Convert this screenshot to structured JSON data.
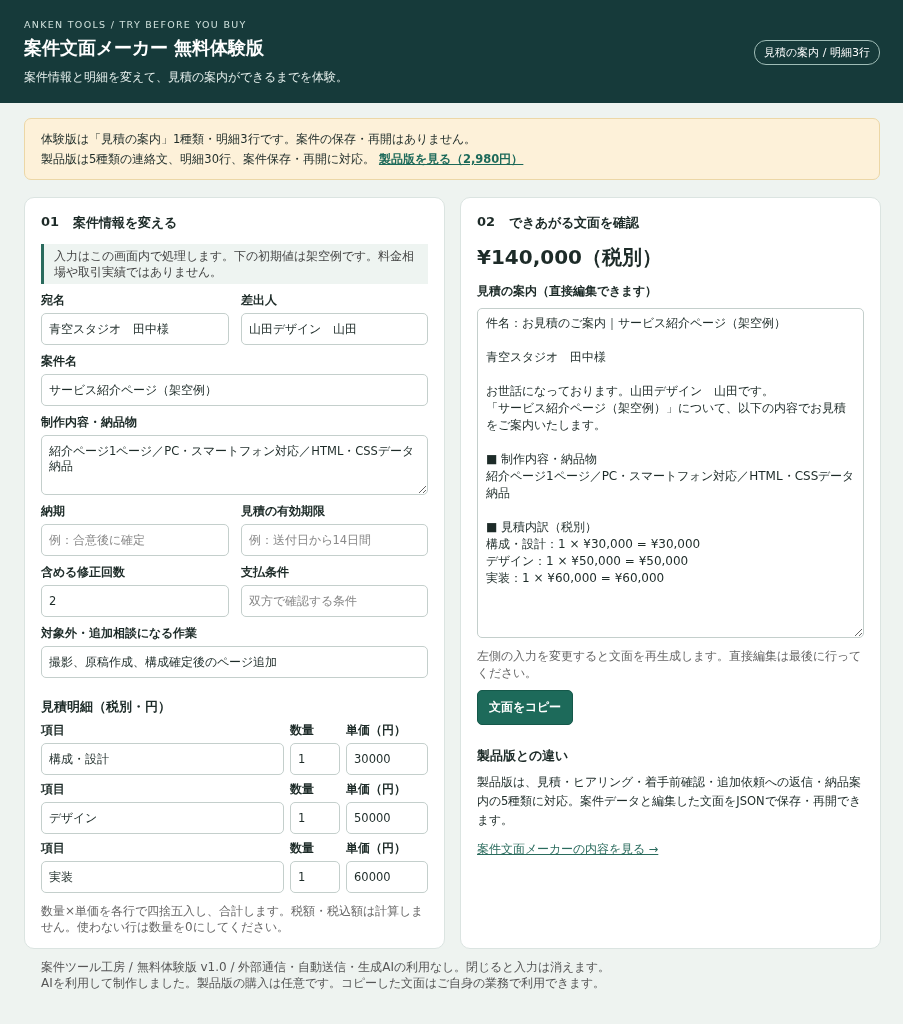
{
  "header": {
    "eyebrow": "ANKEN TOOLS / TRY BEFORE YOU BUY",
    "title": "案件文面メーカー 無料体験版",
    "subtitle": "案件情報と明細を変えて、見積の案内ができるまでを体験。",
    "badge": "見積の案内 / 明細3行"
  },
  "notice": {
    "line1": "体験版は「見積の案内」1種類・明細3行です。案件の保存・再開はありません。",
    "line2": "製品版は5種類の連絡文、明細30行、案件保存・再開に対応。",
    "link": "製品版を見る（2,980円）"
  },
  "input_panel": {
    "number": "01",
    "title": "案件情報を変える",
    "note": "入力はこの画面内で処理します。下の初期値は架空例です。料金相場や取引実績ではありません。",
    "field_rows": [
      [
        {
          "kind": "input",
          "label": "宛名",
          "value": "青空スタジオ　田中様"
        },
        {
          "kind": "input",
          "label": "差出人",
          "value": "山田デザイン　山田"
        }
      ],
      [
        {
          "kind": "input",
          "label": "案件名",
          "value": "サービス紹介ページ（架空例）"
        }
      ],
      [
        {
          "kind": "textarea",
          "label": "制作内容・納品物",
          "value": "紹介ページ1ページ／PC・スマートフォン対応／HTML・CSSデータ納品"
        }
      ],
      [
        {
          "kind": "input",
          "label": "納期",
          "placeholder": "例：合意後に確定"
        },
        {
          "kind": "input",
          "label": "見積の有効期限",
          "placeholder": "例：送付日から14日間"
        }
      ],
      [
        {
          "kind": "input",
          "label": "含める修正回数",
          "value": "2"
        },
        {
          "kind": "input",
          "label": "支払条件",
          "placeholder": "双方で確認する条件"
        }
      ],
      [
        {
          "kind": "input",
          "label": "対象外・追加相談になる作業",
          "value": "撮影、原稿作成、構成確定後のページ追加"
        }
      ]
    ],
    "items_title": "見積明細（税別・円）",
    "items": [
      {
        "item_label": "項目",
        "item": "構成・設計",
        "qty_label": "数量",
        "qty": "1",
        "price_label": "単価（円）",
        "price": "30000"
      },
      {
        "item_label": "項目",
        "item": "デザイン",
        "qty_label": "数量",
        "qty": "1",
        "price_label": "単価（円）",
        "price": "50000"
      },
      {
        "item_label": "項目",
        "item": "実装",
        "qty_label": "数量",
        "qty": "1",
        "price_label": "単価（円）",
        "price": "60000"
      }
    ],
    "footnote": "数量×単価を各行で四捨五入し、合計します。税額・税込額は計算しません。使わない行は数量を0にしてください。"
  },
  "output_panel": {
    "number": "02",
    "title": "できあがる文面を確認",
    "total": "¥140,000（税別）",
    "message_label": "見積の案内（直接編集できます）",
    "message_paragraphs": [
      [
        "件名：お見積のご案内｜サービス紹介ページ（架空例）"
      ],
      [
        "青空スタジオ　田中様"
      ],
      [
        "お世話になっております。山田デザイン　山田です。",
        "「サービス紹介ページ（架空例）」について、以下の内容でお見積をご案内いたします。"
      ],
      [
        "■ 制作内容・納品物",
        "紹介ページ1ページ／PC・スマートフォン対応／HTML・CSSデータ納品"
      ],
      [
        "■ 見積内訳（税別）",
        "構成・設計：1 × ¥30,000 = ¥30,000",
        "デザイン：1 × ¥50,000 = ¥50,000",
        "実装：1 × ¥60,000 = ¥60,000"
      ]
    ],
    "hint": "左側の入力を変更すると文面を再生成します。直接編集は最後に行ってください。",
    "copy_button": "文面をコピー",
    "compare_title": "製品版との違い",
    "compare_text": "製品版は、見積・ヒアリング・着手前確認・追加依頼への返信・納品案内の5種類に対応。案件データと編集した文面をJSONで保存・再開できます。",
    "compare_link": "案件文面メーカーの内容を見る →"
  },
  "footer": {
    "line1": "案件ツール工房 / 無料体験版 v1.0 / 外部通信・自動送信・生成AIの利用なし。閉じると入力は消えます。",
    "line2": "AIを利用して制作しました。製品版の購入は任意です。コピーした文面はご自身の業務で利用できます。"
  }
}
